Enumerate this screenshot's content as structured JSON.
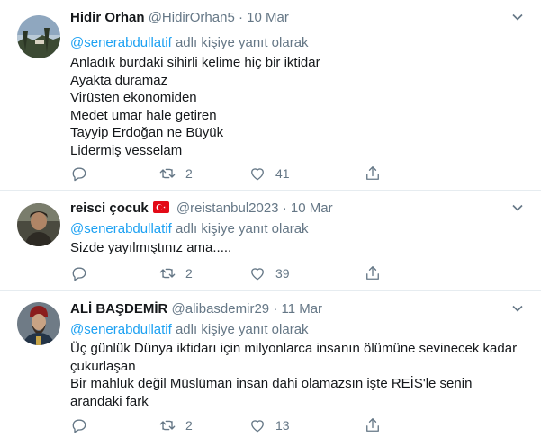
{
  "tweets": [
    {
      "name": "Hidir Orhan",
      "handle": "@HidirOrhan5",
      "dot": "·",
      "date": "10 Mar",
      "reply_mention": "@senerabdullatif",
      "reply_suffix": " adlı kişiye yanıt olarak",
      "lines": [
        "Anladık burdaki sihirli kelime hiç bir iktidar",
        "Ayakta duramaz",
        "Virüsten ekonomiden",
        "Medet umar hale getiren",
        "Tayyip Erdoğan ne Büyük",
        "Lidermiş vesselam"
      ],
      "retweets": "2",
      "likes": "41"
    },
    {
      "name": "reisci çocuk",
      "handle": "@reistanbul2023",
      "dot": "·",
      "date": "10 Mar",
      "reply_mention": "@senerabdullatif",
      "reply_suffix": " adlı kişiye yanıt olarak",
      "lines": [
        "Sizde yayılmıştınız ama....."
      ],
      "retweets": "2",
      "likes": "39"
    },
    {
      "name": "ALİ BAŞDEMİR",
      "handle": "@alibasdemir29",
      "dot": "·",
      "date": "11 Mar",
      "reply_mention": "@senerabdullatif",
      "reply_suffix": " adlı kişiye yanıt olarak",
      "lines": [
        "Üç günlük Dünya iktidarı için milyonlarca insanın ölümüne sevinecek kadar",
        "çukurlaşan",
        "Bir mahluk değil Müslüman insan dahi olamazsın işte REİS'le senin",
        "arandaki fark"
      ],
      "retweets": "2",
      "likes": "13"
    }
  ],
  "icons": {
    "reply": "reply-icon",
    "retweet": "retweet-icon",
    "like": "heart-icon",
    "share": "share-icon",
    "caret": "chevron-down-icon",
    "flag": "turkey-flag-icon"
  },
  "colors": {
    "mention": "#1da1f2",
    "secondary_text": "#657786",
    "primary_text": "#14171a",
    "divider": "#e6ecf0"
  }
}
